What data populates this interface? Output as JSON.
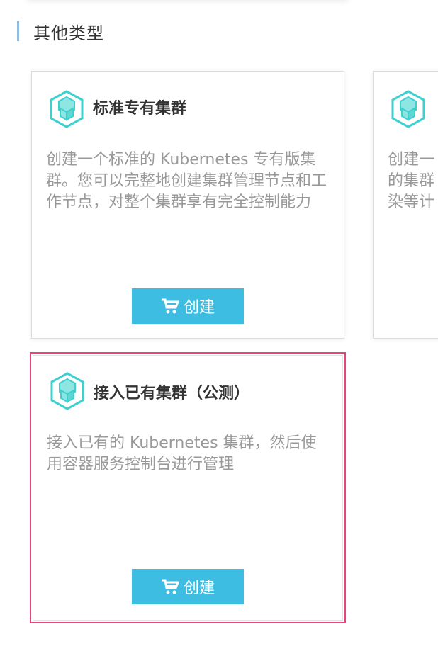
{
  "section": {
    "title": "其他类型"
  },
  "cards": [
    {
      "title": "标准专有集群",
      "description": "创建一个标准的 Kubernetes 专有版集群。您可以完整地创建集群管理节点和工作节点，对整个集群享有完全控制能力",
      "button_label": "创建"
    },
    {
      "title": "接入已有集群（公测）",
      "description": "接入已有的 Kubernetes 集群，然后使用容器服务控制台进行管理",
      "button_label": "创建"
    },
    {
      "title": "",
      "description": "创建一\n的集群\n染等计",
      "button_label": ""
    }
  ],
  "colors": {
    "accent_bar": "#8fbbe0",
    "button": "#3ebde2",
    "highlight_border": "#e6447a",
    "icon": "#3ecfcf"
  },
  "icons": {
    "card_icon": "kubernetes-cube-icon",
    "button_icon": "cart-icon"
  }
}
